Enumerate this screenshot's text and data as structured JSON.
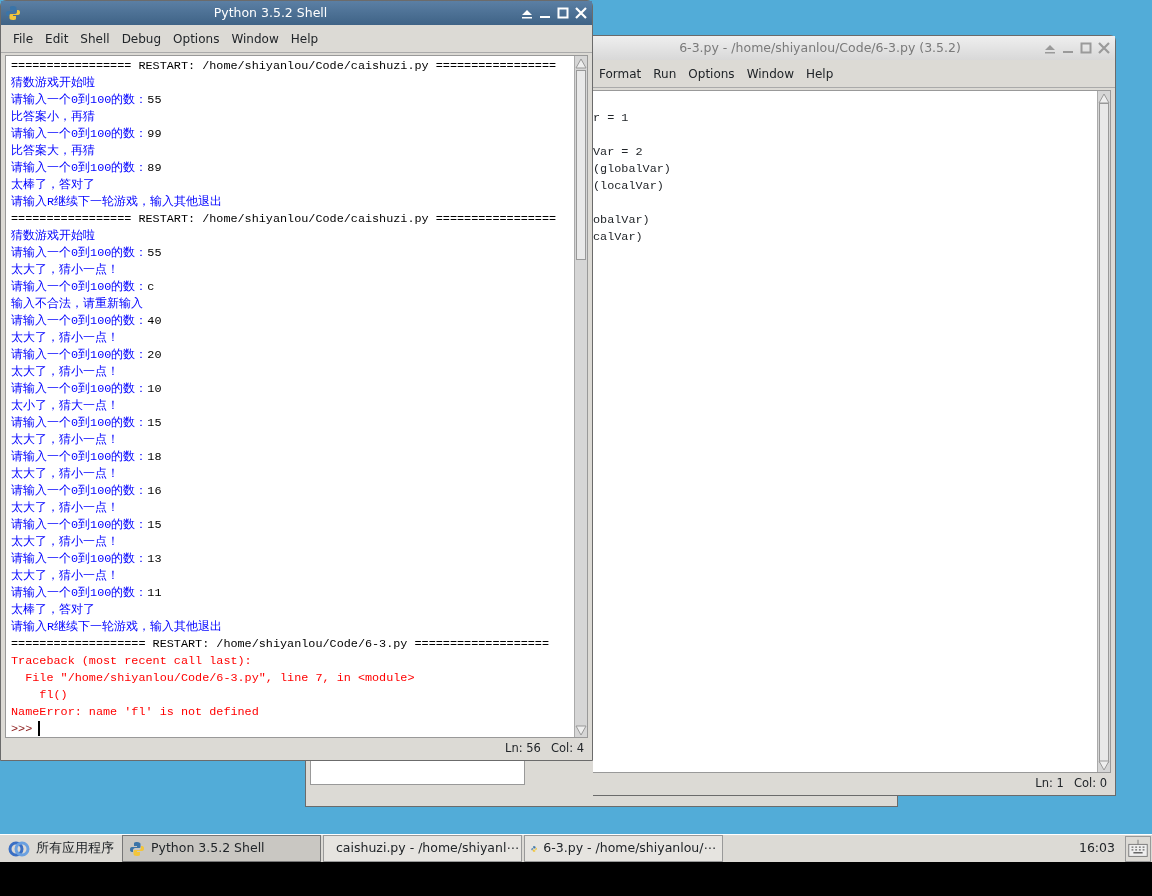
{
  "editor_window": {
    "active": false,
    "title": "6-3.py - /home/shiyanlou/Code/6-3.py (3.5.2)",
    "menu": [
      "Format",
      "Run",
      "Options",
      "Window",
      "Help"
    ],
    "code_lines": [
      {
        "kind": "blank"
      },
      {
        "kind": "code",
        "text": "r = 1"
      },
      {
        "kind": "blank"
      },
      {
        "kind": "code",
        "text": "Var = 2"
      },
      {
        "kind": "code",
        "text": "(globalVar)"
      },
      {
        "kind": "code",
        "text": "(localVar)"
      },
      {
        "kind": "blank"
      },
      {
        "kind": "code",
        "text": "obalVar)"
      },
      {
        "kind": "code",
        "text": "calVar)"
      }
    ],
    "status": {
      "line": "Ln: 1",
      "col": "Col: 0"
    }
  },
  "shell_window": {
    "active": true,
    "title": "Python 3.5.2 Shell",
    "menu": [
      "File",
      "Edit",
      "Shell",
      "Debug",
      "Options",
      "Window",
      "Help"
    ],
    "lines": [
      {
        "kind": "restart",
        "text": "================= RESTART: /home/shiyanlou/Code/caishuzi.py ================="
      },
      {
        "kind": "output",
        "text": "猜数游戏开始啦"
      },
      {
        "kind": "prompt",
        "text": "请输入一个0到100的数：",
        "input": "55"
      },
      {
        "kind": "output",
        "text": "比答案小，再猜"
      },
      {
        "kind": "prompt",
        "text": "请输入一个0到100的数：",
        "input": "99"
      },
      {
        "kind": "output",
        "text": "比答案大，再猜"
      },
      {
        "kind": "prompt",
        "text": "请输入一个0到100的数：",
        "input": "89"
      },
      {
        "kind": "output",
        "text": "太棒了，答对了"
      },
      {
        "kind": "output",
        "text": "请输入R继续下一轮游戏，输入其他退出"
      },
      {
        "kind": "restart",
        "text": "================= RESTART: /home/shiyanlou/Code/caishuzi.py ================="
      },
      {
        "kind": "output",
        "text": "猜数游戏开始啦"
      },
      {
        "kind": "prompt",
        "text": "请输入一个0到100的数：",
        "input": "55"
      },
      {
        "kind": "output",
        "text": "太大了，猜小一点！"
      },
      {
        "kind": "prompt",
        "text": "请输入一个0到100的数：",
        "input": "c"
      },
      {
        "kind": "output",
        "text": "输入不合法，请重新输入"
      },
      {
        "kind": "prompt",
        "text": "请输入一个0到100的数：",
        "input": "40"
      },
      {
        "kind": "output",
        "text": "太大了，猜小一点！"
      },
      {
        "kind": "prompt",
        "text": "请输入一个0到100的数：",
        "input": "20"
      },
      {
        "kind": "output",
        "text": "太大了，猜小一点！"
      },
      {
        "kind": "prompt",
        "text": "请输入一个0到100的数：",
        "input": "10"
      },
      {
        "kind": "output",
        "text": "太小了，猜大一点！"
      },
      {
        "kind": "prompt",
        "text": "请输入一个0到100的数：",
        "input": "15"
      },
      {
        "kind": "output",
        "text": "太大了，猜小一点！"
      },
      {
        "kind": "prompt",
        "text": "请输入一个0到100的数：",
        "input": "18"
      },
      {
        "kind": "output",
        "text": "太大了，猜小一点！"
      },
      {
        "kind": "prompt",
        "text": "请输入一个0到100的数：",
        "input": "16"
      },
      {
        "kind": "output",
        "text": "太大了，猜小一点！"
      },
      {
        "kind": "prompt",
        "text": "请输入一个0到100的数：",
        "input": "15"
      },
      {
        "kind": "output",
        "text": "太大了，猜小一点！"
      },
      {
        "kind": "prompt",
        "text": "请输入一个0到100的数：",
        "input": "13"
      },
      {
        "kind": "output",
        "text": "太大了，猜小一点！"
      },
      {
        "kind": "prompt",
        "text": "请输入一个0到100的数：",
        "input": "11"
      },
      {
        "kind": "output",
        "text": "太棒了，答对了"
      },
      {
        "kind": "output",
        "text": "请输入R继续下一轮游戏，输入其他退出"
      },
      {
        "kind": "restart",
        "text": "=================== RESTART: /home/shiyanlou/Code/6-3.py ==================="
      },
      {
        "kind": "error",
        "text": "Traceback (most recent call last):"
      },
      {
        "kind": "error",
        "text": "  File \"/home/shiyanlou/Code/6-3.py\", line 7, in <module>"
      },
      {
        "kind": "error",
        "text": "    fl()"
      },
      {
        "kind": "error",
        "text": "NameError: name 'fl' is not defined"
      },
      {
        "kind": "cursor",
        "text": ">>>"
      }
    ],
    "status": {
      "line": "Ln: 56",
      "col": "Col: 4"
    }
  },
  "taskbar": {
    "start_label": "所有应用程序",
    "tasks": [
      {
        "label": "Python 3.5.2 Shell",
        "selected": true
      },
      {
        "label": "caishuzi.py - /home/shiyanl⋯",
        "selected": false
      },
      {
        "label": "6-3.py - /home/shiyanlou/⋯",
        "selected": false
      }
    ],
    "clock": "16:03"
  }
}
